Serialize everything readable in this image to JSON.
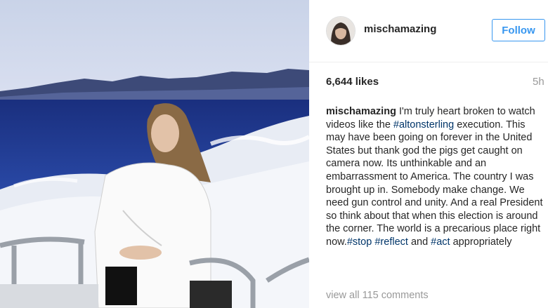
{
  "post": {
    "username": "mischamazing",
    "follow_label": "Follow",
    "likes": "6,644 likes",
    "time_ago": "5h",
    "view_comments": "view all 115 comments"
  },
  "caption": {
    "username": "mischamazing",
    "segments": [
      " I'm truly heart broken to watch videos like the ",
      "#altonsterling",
      " execution. This may have been going on forever in the United States but thank god the pigs get caught on camera now. Its unthinkable and an embarrassment to America. The country I was brought up in. Somebody make change. We need gun control and unity. And a real President so think about that when this election is around the corner. The world is a precarious place right now.",
      "#stop",
      " ",
      "#reflect",
      " and ",
      "#act",
      " appropriately"
    ]
  },
  "colors": {
    "accent": "#3897f0",
    "hashtag": "#003569",
    "muted": "#999999"
  }
}
